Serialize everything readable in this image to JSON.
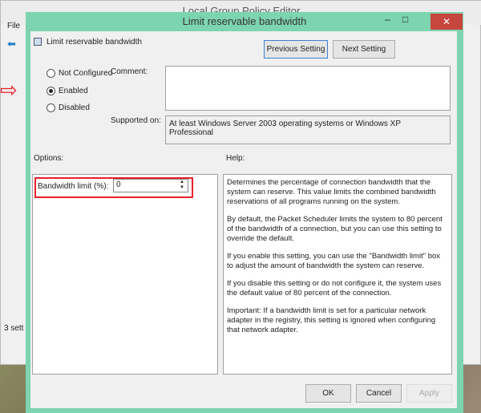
{
  "parent": {
    "title": "Local Group Policy Editor",
    "menu_file": "File",
    "status": "3 sett"
  },
  "dialog": {
    "title": "Limit reservable bandwidth",
    "setting_name": "Limit reservable bandwidth",
    "previous": "Previous Setting",
    "next": "Next Setting",
    "radios": [
      {
        "label": "Not Configured",
        "checked": false
      },
      {
        "label": "Enabled",
        "checked": true
      },
      {
        "label": "Disabled",
        "checked": false
      }
    ],
    "comment_label": "Comment:",
    "supported_label": "Supported on:",
    "supported_value": "At least Windows Server 2003 operating systems or Windows XP Professional",
    "options_label": "Options:",
    "help_label": "Help:",
    "bandwidth_label": "Bandwidth limit (%):",
    "bandwidth_value": "0",
    "help": [
      "Determines the percentage of connection bandwidth that the system can reserve. This value limits the combined bandwidth reservations of all programs running on the system.",
      "By default, the Packet Scheduler limits the system to 80 percent of the bandwidth of a connection, but you can use this setting to override the default.",
      "If you enable this setting, you can use the \"Bandwidth limit\" box to adjust the amount of bandwidth the system can reserve.",
      "If you disable this setting or do not configure it, the system uses the default value of 80 percent of the connection.",
      "Important: If a bandwidth limit is set for a particular network adapter in the registry, this setting is ignored when configuring that network adapter."
    ],
    "ok": "OK",
    "cancel": "Cancel",
    "apply": "Apply"
  },
  "colors": {
    "frame": "#7dd4b0",
    "close": "#c7463e",
    "highlight": "#e8202a"
  }
}
